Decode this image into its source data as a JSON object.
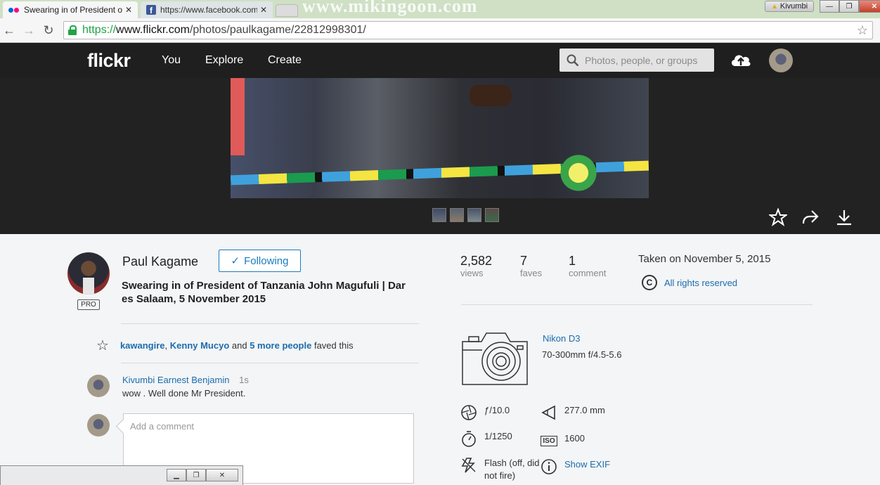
{
  "browser": {
    "tabs": [
      {
        "label": "Swearing in of President o",
        "icon": "flickr-favicon"
      },
      {
        "label": "https://www.facebook.com",
        "icon": "facebook-favicon"
      }
    ],
    "profile_name": "Kivumbi",
    "url_secure": "https://",
    "url_host": "www.flickr.com",
    "url_path": "/photos/paulkagame/22812998301/"
  },
  "header": {
    "logo": "flickr",
    "nav": [
      "You",
      "Explore",
      "Create"
    ],
    "search_placeholder": "Photos, people, or groups"
  },
  "owner": {
    "name": "Paul Kagame",
    "pro_label": "PRO",
    "follow_label": "Following"
  },
  "photo": {
    "title": "Swearing in of President of Tanzania John Magufuli | Dar es Salaam, 5 November 2015",
    "thumb_count": 4
  },
  "faves": {
    "user1": "kawangire",
    "sep": ", ",
    "user2": "Kenny Mucyo",
    "and_text": " and ",
    "more_link": "5 more people",
    "suffix": " faved this"
  },
  "comments": [
    {
      "author": "Kivumbi Earnest Benjamin",
      "time": "1s",
      "text": "wow . Well done Mr President."
    }
  ],
  "comment_box": {
    "placeholder": "Add a comment"
  },
  "stats": [
    {
      "value": "2,582",
      "label": "views"
    },
    {
      "value": "7",
      "label": "faves"
    },
    {
      "value": "1",
      "label": "comment"
    }
  ],
  "taken": "Taken on November 5, 2015",
  "rights": {
    "symbol": "C",
    "label": "All rights reserved"
  },
  "camera": {
    "model": "Nikon D3",
    "lens": "70-300mm f/4.5-5.6"
  },
  "exif": {
    "aperture": "ƒ/10.0",
    "focal_length": "277.0 mm",
    "shutter": "1/1250",
    "iso_label": "ISO",
    "iso": "1600",
    "flash": "Flash (off, did not fire)",
    "show_exif": "Show EXIF"
  },
  "colors": {
    "accent": "#1c7bbd",
    "link": "#1c6cae",
    "header_bg": "#1f1f1f",
    "page_bg": "#f3f5f6"
  }
}
